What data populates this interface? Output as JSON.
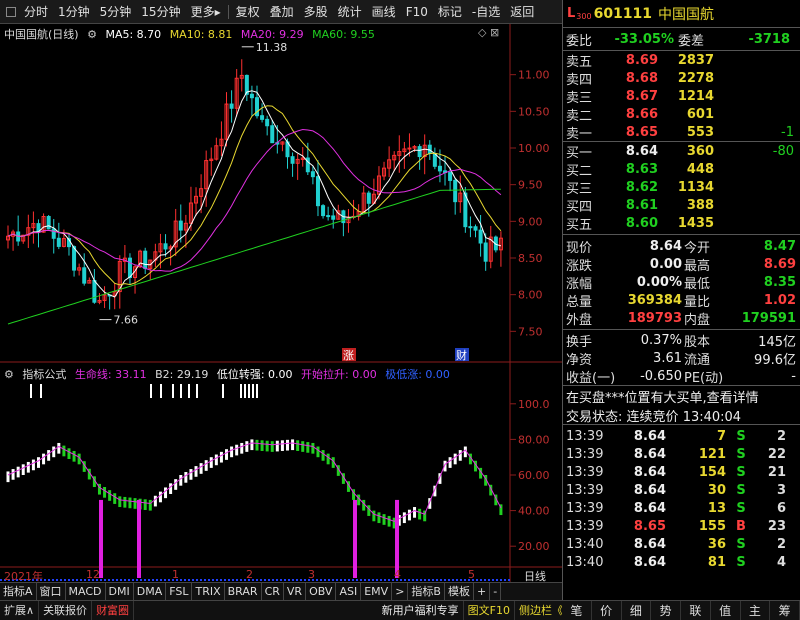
{
  "toolbar": {
    "left": [
      "分时",
      "1分钟",
      "5分钟",
      "15分钟",
      "更多"
    ],
    "right": [
      "复权",
      "叠加",
      "多股",
      "统计",
      "画线",
      "F10",
      "标记"
    ],
    "self_select": "自选",
    "back": "返回"
  },
  "chart": {
    "title": "中国国航(日线)",
    "ma5": "MA5: 8.70",
    "ma10": "MA10: 8.81",
    "ma20": "MA20: 9.29",
    "ma60": "MA60: 9.55",
    "high_label": "11.38",
    "low_label": "7.66",
    "price_axis": [
      "11.00",
      "10.50",
      "10.00",
      "9.50",
      "9.00",
      "8.50",
      "8.00",
      "7.50"
    ],
    "marker_up": "涨",
    "marker_fin": "财",
    "colors": {
      "up": "#ff3030",
      "down": "#20d0d0",
      "ma5": "#ffffff",
      "ma10": "#e8d830",
      "ma20": "#e030e0",
      "ma60": "#20d020"
    }
  },
  "indicator": {
    "name": "指标公式",
    "line1": "生命线: 33.11",
    "line2": "B2: 29.19",
    "line3": "低位转强: 0.00",
    "line4": "开始拉升: 0.00",
    "line5": "极低涨: 0.00",
    "axis": [
      "100.0",
      "80.00",
      "60.00",
      "40.00",
      "20.00"
    ]
  },
  "timeline": {
    "year": "2021年",
    "months": [
      "12",
      "1",
      "2",
      "3",
      "4",
      "5"
    ],
    "period": "日线"
  },
  "bottom_tabs": [
    "指标A",
    "窗口",
    "MACD",
    "DMI",
    "DMA",
    "FSL",
    "TRIX",
    "BRAR",
    "CR",
    "VR",
    "OBV",
    "ASI",
    "EMV",
    ">",
    "指标B",
    "模板",
    "+",
    "-"
  ],
  "status_bar": [
    "扩展∧",
    "关联报价",
    "财富圈",
    "新用户福利专享",
    "图文F10",
    "侧边栏《"
  ],
  "quote": {
    "l_label": "L",
    "code_num": "300",
    "code": "601111",
    "name": "中国国航",
    "weibi_label": "委比",
    "weibi": "-33.05%",
    "weicha_label": "委差",
    "weicha": "-3718",
    "sells": [
      {
        "label": "卖五",
        "price": "8.69",
        "vol": "2837",
        "chg": ""
      },
      {
        "label": "卖四",
        "price": "8.68",
        "vol": "2278",
        "chg": ""
      },
      {
        "label": "卖三",
        "price": "8.67",
        "vol": "1214",
        "chg": ""
      },
      {
        "label": "卖二",
        "price": "8.66",
        "vol": "601",
        "chg": ""
      },
      {
        "label": "卖一",
        "price": "8.65",
        "vol": "553",
        "chg": "-1"
      }
    ],
    "buys": [
      {
        "label": "买一",
        "price": "8.64",
        "vol": "360",
        "chg": "-80"
      },
      {
        "label": "买二",
        "price": "8.63",
        "vol": "448",
        "chg": ""
      },
      {
        "label": "买三",
        "price": "8.62",
        "vol": "1134",
        "chg": ""
      },
      {
        "label": "买四",
        "price": "8.61",
        "vol": "388",
        "chg": ""
      },
      {
        "label": "买五",
        "price": "8.60",
        "vol": "1435",
        "chg": ""
      }
    ],
    "stats": [
      {
        "l1": "现价",
        "v1": "8.64",
        "c1": "white",
        "l2": "今开",
        "v2": "8.47",
        "c2": "green"
      },
      {
        "l1": "涨跌",
        "v1": "0.00",
        "c1": "white",
        "l2": "最高",
        "v2": "8.69",
        "c2": "red"
      },
      {
        "l1": "涨幅",
        "v1": "0.00%",
        "c1": "white",
        "l2": "最低",
        "v2": "8.35",
        "c2": "green"
      },
      {
        "l1": "总量",
        "v1": "369384",
        "c1": "yellow",
        "l2": "量比",
        "v2": "1.02",
        "c2": "red"
      },
      {
        "l1": "外盘",
        "v1": "189793",
        "c1": "red",
        "l2": "内盘",
        "v2": "179591",
        "c2": "green"
      }
    ],
    "stats2": [
      {
        "l1": "换手",
        "v1": "0.37%",
        "l2": "股本",
        "v2": "145亿"
      },
      {
        "l1": "净资",
        "v1": "3.61",
        "l2": "流通",
        "v2": "99.6亿"
      },
      {
        "l1": "收益(一)",
        "v1": "-0.650",
        "l2": "PE(动)",
        "v2": "-"
      }
    ],
    "news": "在买盘***位置有大买单,查看详情",
    "trade_state_label": "交易状态:",
    "trade_state": "连续竞价",
    "trade_time": "13:40:04",
    "ticks": [
      {
        "t": "13:39",
        "p": "8.64",
        "pc": "white",
        "v": "7",
        "f": "S",
        "fc": "green",
        "n": "2"
      },
      {
        "t": "13:39",
        "p": "8.64",
        "pc": "white",
        "v": "121",
        "f": "S",
        "fc": "green",
        "n": "22"
      },
      {
        "t": "13:39",
        "p": "8.64",
        "pc": "white",
        "v": "154",
        "f": "S",
        "fc": "green",
        "n": "21"
      },
      {
        "t": "13:39",
        "p": "8.64",
        "pc": "white",
        "v": "30",
        "f": "S",
        "fc": "green",
        "n": "3"
      },
      {
        "t": "13:39",
        "p": "8.64",
        "pc": "white",
        "v": "13",
        "f": "S",
        "fc": "green",
        "n": "6"
      },
      {
        "t": "13:39",
        "p": "8.65",
        "pc": "red",
        "v": "155",
        "f": "B",
        "fc": "red",
        "n": "23"
      },
      {
        "t": "13:40",
        "p": "8.64",
        "pc": "white",
        "v": "36",
        "f": "S",
        "fc": "green",
        "n": "2"
      },
      {
        "t": "13:40",
        "p": "8.64",
        "pc": "white",
        "v": "81",
        "f": "S",
        "fc": "green",
        "n": "4"
      }
    ],
    "tabs": [
      "笔",
      "价",
      "细",
      "势",
      "联",
      "值",
      "主",
      "筹"
    ]
  }
}
